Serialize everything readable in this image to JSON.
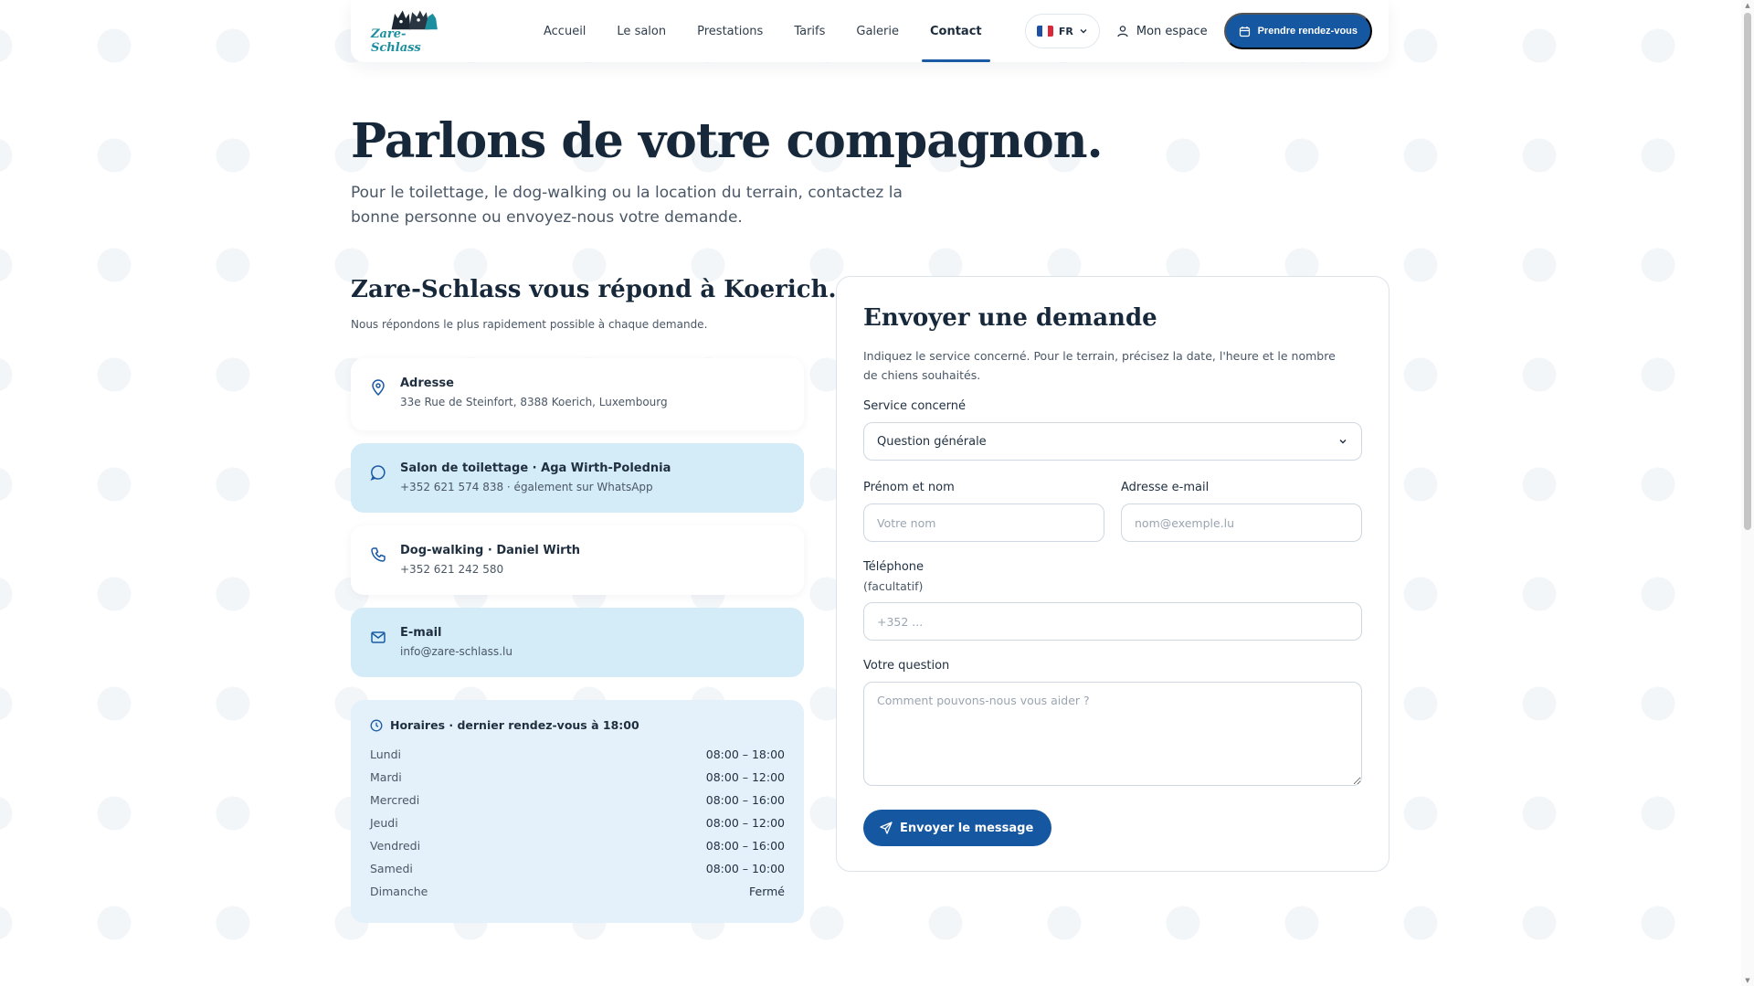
{
  "brand": {
    "logo_text": "Zare-Schlass"
  },
  "nav": {
    "items": [
      {
        "label": "Accueil"
      },
      {
        "label": "Le salon"
      },
      {
        "label": "Prestations"
      },
      {
        "label": "Tarifs"
      },
      {
        "label": "Galerie"
      },
      {
        "label": "Contact",
        "active": true
      }
    ],
    "lang": "FR",
    "account": "Mon espace",
    "cta": "Prendre rendez-vous"
  },
  "hero": {
    "title": "Parlons de votre compagnon.",
    "subtitle": "Pour le toilettage, le dog-walking ou la location du terrain, contactez la bonne personne ou envoyez-nous votre demande."
  },
  "contact": {
    "title": "Zare-Schlass vous répond à Koerich.",
    "subtitle": "Nous répondons le plus rapidement possible à chaque demande.",
    "cards": [
      {
        "title": "Adresse",
        "value": "33e Rue de Steinfort, 8388 Koerich, Luxembourg",
        "icon": "map-pin-icon"
      },
      {
        "title": "Salon de toilettage · Aga Wirth-Polednia",
        "value": "+352 621 574 838 · également sur WhatsApp",
        "icon": "chat-bubble-icon"
      },
      {
        "title": "Dog-walking · Daniel Wirth",
        "value": "+352 621 242 580",
        "icon": "phone-icon"
      },
      {
        "title": "E-mail",
        "value": "info@zare-schlass.lu",
        "icon": "mail-icon"
      }
    ],
    "hours": {
      "title": "Horaires · dernier rendez-vous à 18:00",
      "rows": [
        {
          "day": "Lundi",
          "time": "08:00 – 18:00"
        },
        {
          "day": "Mardi",
          "time": "08:00 – 12:00"
        },
        {
          "day": "Mercredi",
          "time": "08:00 – 16:00"
        },
        {
          "day": "Jeudi",
          "time": "08:00 – 12:00"
        },
        {
          "day": "Vendredi",
          "time": "08:00 – 16:00"
        },
        {
          "day": "Samedi",
          "time": "08:00 – 10:00"
        },
        {
          "day": "Dimanche",
          "time": "Fermé"
        }
      ]
    }
  },
  "form": {
    "title": "Envoyer une demande",
    "description": "Indiquez le service concerné. Pour le terrain, précisez la date, l'heure et le nombre de chiens souhaités.",
    "service_label": "Service concerné",
    "service_value": "Question générale",
    "name_label": "Prénom et nom",
    "name_placeholder": "Votre nom",
    "email_label": "Adresse e-mail",
    "email_placeholder": "nom@exemple.lu",
    "phone_label": "Téléphone",
    "phone_note": "(facultatif)",
    "phone_placeholder": "+352 ...",
    "question_label": "Votre question",
    "question_placeholder": "Comment pouvons-nous vous aider ?",
    "submit": "Envoyer le message"
  },
  "colors": {
    "primary": "#1557a0",
    "card_blue": "#d4ebf8",
    "hours_bg": "#e4f1fa",
    "brand_teal": "#1c8f9e"
  }
}
